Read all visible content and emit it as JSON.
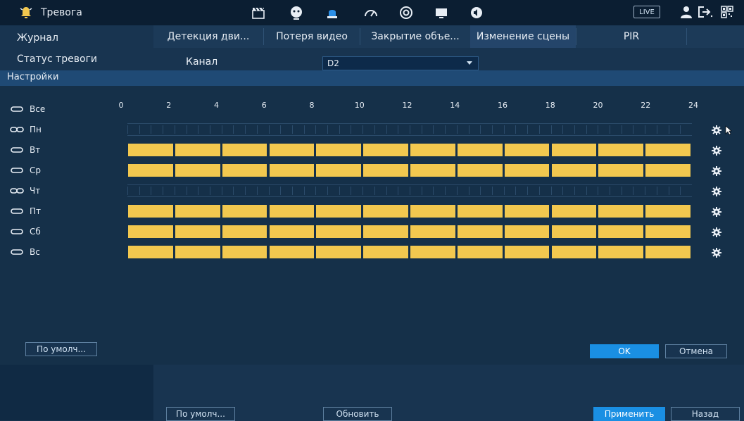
{
  "topbar": {
    "title": "Тревога",
    "live_label": "LIVE",
    "icons": [
      "bell-icon",
      "clapperboard-icon",
      "face-icon",
      "siren-icon",
      "gauge-icon",
      "target-icon",
      "monitor-icon",
      "speaker-icon",
      "user-icon",
      "logout-icon",
      "qr-icon"
    ]
  },
  "left_menu": {
    "items": [
      {
        "label": "Журнал"
      },
      {
        "label": "Статус тревоги"
      }
    ]
  },
  "tabs": [
    {
      "label": "Детекция дви...",
      "active": false
    },
    {
      "label": "Потеря видео",
      "active": false
    },
    {
      "label": "Закрытие объе...",
      "active": false
    },
    {
      "label": "Изменение сцены",
      "active": true
    },
    {
      "label": "PIR",
      "active": false
    }
  ],
  "channel": {
    "label": "Канал",
    "value": "D2"
  },
  "settings": {
    "title": "Настройки",
    "hours": [
      "0",
      "2",
      "4",
      "6",
      "8",
      "10",
      "12",
      "14",
      "16",
      "18",
      "20",
      "22",
      "24"
    ],
    "days": [
      {
        "label": "Все",
        "link": "unlinked",
        "has_bar": false
      },
      {
        "label": "Пн",
        "link": "linked",
        "has_bar": false
      },
      {
        "label": "Вт",
        "link": "unlinked",
        "has_bar": true
      },
      {
        "label": "Ср",
        "link": "unlinked",
        "has_bar": true
      },
      {
        "label": "Чт",
        "link": "linked",
        "has_bar": false
      },
      {
        "label": "Пт",
        "link": "unlinked",
        "has_bar": true
      },
      {
        "label": "Сб",
        "link": "unlinked",
        "has_bar": true
      },
      {
        "label": "Вс",
        "link": "unlinked",
        "has_bar": true
      }
    ],
    "schedule_color": "#f2c84f",
    "default_label": "По умолч...",
    "ok_label": "OK",
    "cancel_label": "Отмена"
  },
  "footer": {
    "default_label": "По умолч...",
    "refresh_label": "Обновить",
    "apply_label": "Применить",
    "back_label": "Назад"
  }
}
